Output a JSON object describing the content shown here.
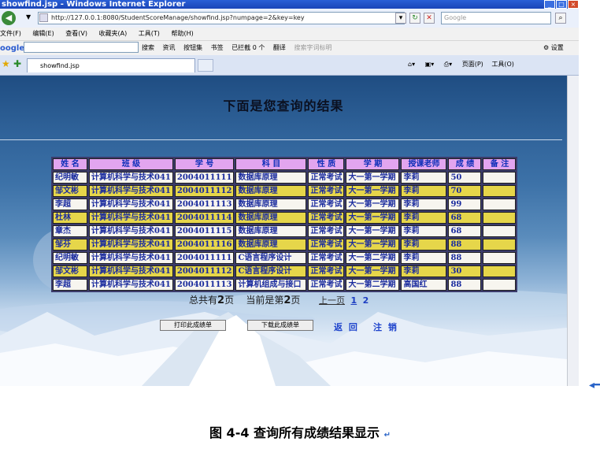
{
  "window": {
    "title": "showfind.jsp - Windows Internet Explorer",
    "controls": [
      "_",
      "□",
      "×"
    ]
  },
  "address_bar": {
    "url": "http://127.0.0.1:8080/StudentScoreManage/showfind.jsp?numpage=2&key=key",
    "search_placeholder": "Google"
  },
  "menu": [
    "文件(F)",
    "编辑(E)",
    "查看(V)",
    "收藏夹(A)",
    "工具(T)",
    "帮助(H)"
  ],
  "google_toolbar": {
    "logo": "oogle",
    "items": [
      "搜索",
      "资讯",
      "按钮集",
      "书签",
      "已拦截 0 个",
      "翻译",
      "搜索字词标明"
    ],
    "settings": "设置"
  },
  "tab": {
    "label": "showfind.jsp"
  },
  "command_bar": {
    "page": "页面(P)",
    "tools": "工具(O)"
  },
  "page": {
    "heading": "下面是您查询的结果",
    "columns": [
      "姓 名",
      "班 级",
      "学 号",
      "科 目",
      "性 质",
      "学 期",
      "授课老师",
      "成 绩",
      "备 注"
    ],
    "rows": [
      [
        "纪明敏",
        "计算机科学与技术041",
        "2004011111",
        "数据库原理",
        "正常考试",
        "大一第一学期",
        "李莉",
        "50",
        ""
      ],
      [
        "邹文彬",
        "计算机科学与技术041",
        "2004011112",
        "数据库原理",
        "正常考试",
        "大一第一学期",
        "李莉",
        "70",
        ""
      ],
      [
        "李超",
        "计算机科学与技术041",
        "2004011113",
        "数据库原理",
        "正常考试",
        "大一第一学期",
        "李莉",
        "99",
        ""
      ],
      [
        "杜林",
        "计算机科学与技术041",
        "2004011114",
        "数据库原理",
        "正常考试",
        "大一第一学期",
        "李莉",
        "68",
        ""
      ],
      [
        "章杰",
        "计算机科学与技术041",
        "2004011115",
        "数据库原理",
        "正常考试",
        "大一第一学期",
        "李莉",
        "68",
        ""
      ],
      [
        "邹芬",
        "计算机科学与技术041",
        "2004011116",
        "数据库原理",
        "正常考试",
        "大一第一学期",
        "李莉",
        "88",
        ""
      ],
      [
        "纪明敏",
        "计算机科学与技术041",
        "2004011111",
        "C语言程序设计",
        "正常考试",
        "大一第二学期",
        "李莉",
        "88",
        ""
      ],
      [
        "邹文彬",
        "计算机科学与技术041",
        "2004011112",
        "C语言程序设计",
        "正常考试",
        "大一第一学期",
        "李莉",
        "30",
        ""
      ],
      [
        "李超",
        "计算机科学与技术041",
        "2004011113",
        "计算机组成与接口",
        "正常考试",
        "大一第二学期",
        "高国红",
        "88",
        ""
      ]
    ],
    "pagination": {
      "total_prefix": "总共有",
      "total_pages": "2",
      "total_suffix": "页",
      "current_prefix": "当前是第",
      "current_page": "2",
      "current_suffix": "页",
      "prev": "上一页",
      "pages": [
        "1",
        "2"
      ]
    },
    "buttons": {
      "print": "打印此成绩单",
      "download": "下载此成绩单"
    },
    "links": {
      "back": "返 回",
      "logout": "注 销"
    }
  },
  "caption": "图 4-4  查询所有成绩结果显示"
}
